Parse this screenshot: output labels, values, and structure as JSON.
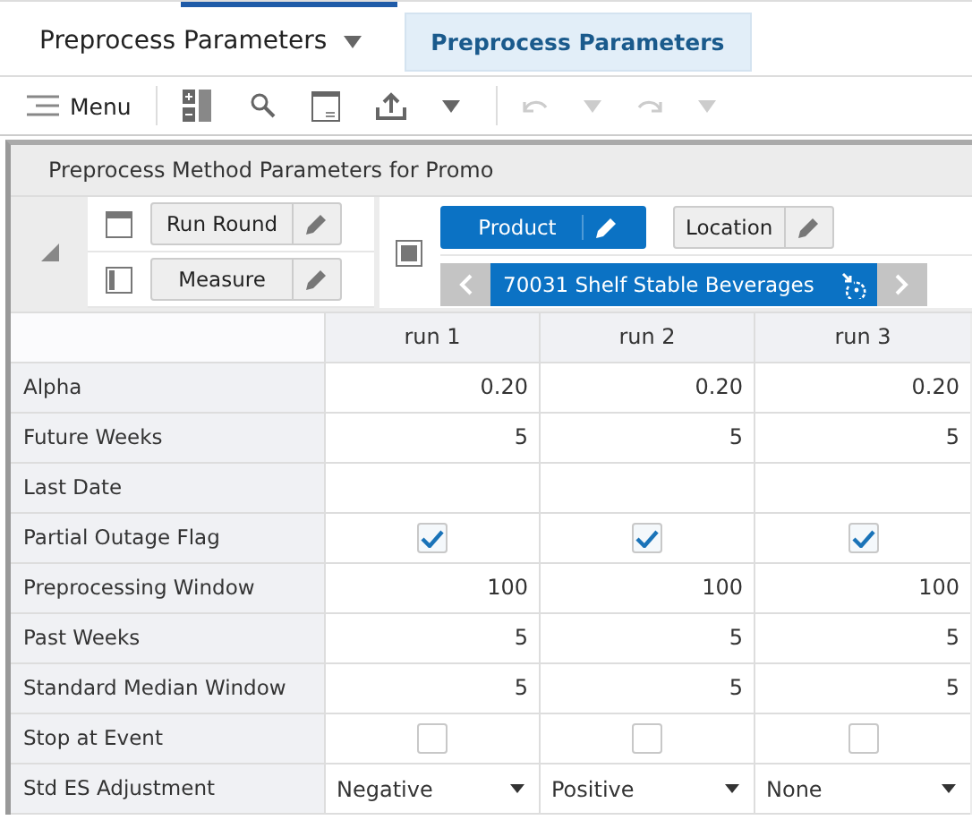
{
  "header": {
    "dropdown_title": "Preprocess Parameters",
    "tabs": [
      {
        "label": "Preprocess Parameters",
        "selected": true
      }
    ]
  },
  "toolbar": {
    "menu_label": "Menu",
    "undo_disabled": true
  },
  "panel": {
    "title": "Preprocess Method Parameters for Promo"
  },
  "pivot": {
    "row_tiles": [
      "Run Round",
      "Measure"
    ],
    "column_tiles": [
      {
        "label": "Product",
        "selected": true
      },
      {
        "label": "Location",
        "selected": false
      }
    ],
    "member": "70031 Shelf Stable Beverages"
  },
  "table": {
    "columns": [
      "run 1",
      "run 2",
      "run 3"
    ],
    "rows": [
      {
        "label": "Alpha",
        "kind": "number",
        "cells": [
          "0.20",
          "0.20",
          "0.20"
        ]
      },
      {
        "label": "Future Weeks",
        "kind": "number",
        "cells": [
          "5",
          "5",
          "5"
        ]
      },
      {
        "label": "Last Date",
        "kind": "blank"
      },
      {
        "label": "Partial Outage Flag",
        "kind": "checkbox",
        "cells": [
          {
            "checked": true
          },
          {
            "checked": true
          },
          {
            "checked": true
          }
        ]
      },
      {
        "label": "Preprocessing Window",
        "kind": "number",
        "cells": [
          "100",
          "100",
          "100"
        ]
      },
      {
        "label": "Past Weeks",
        "kind": "number",
        "cells": [
          "5",
          "5",
          "5"
        ]
      },
      {
        "label": "Standard Median Window",
        "kind": "number",
        "cells": [
          "5",
          "5",
          "5"
        ]
      },
      {
        "label": "Stop at Event",
        "kind": "checkbox",
        "cells": [
          {
            "checked": false
          },
          {
            "checked": false
          },
          {
            "checked": false
          }
        ]
      },
      {
        "label": "Std ES Adjustment",
        "kind": "select",
        "cells": [
          "Negative",
          "Positive",
          "None"
        ]
      }
    ]
  }
}
